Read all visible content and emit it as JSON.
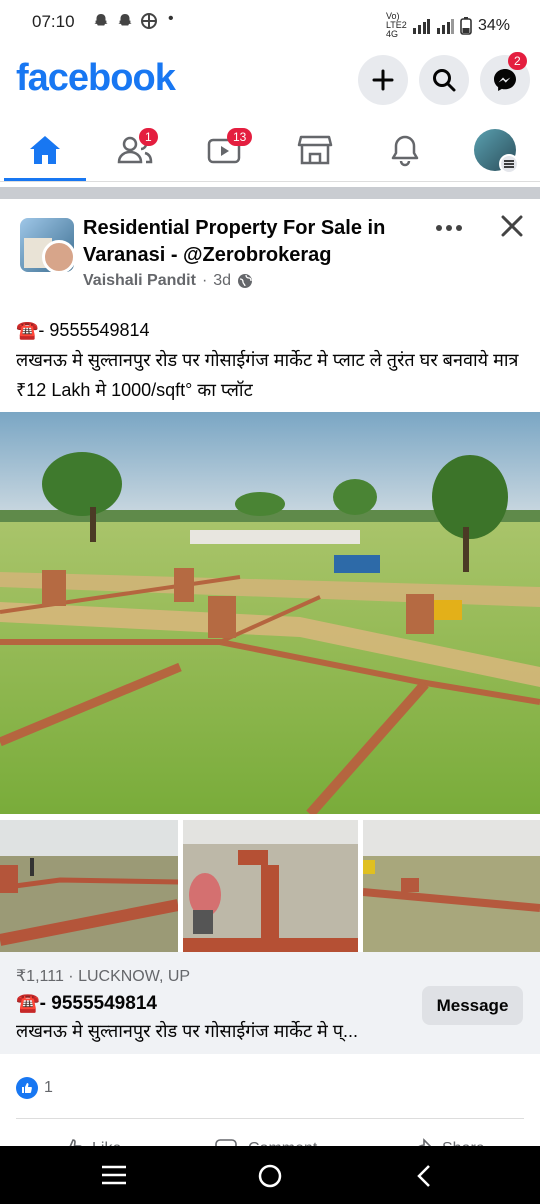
{
  "status_bar": {
    "time": "07:10",
    "network": "Vo) LTE2 4G",
    "battery": "34%"
  },
  "header": {
    "logo": "facebook",
    "messenger_badge": "2"
  },
  "nav": {
    "friends_badge": "1",
    "video_badge": "13"
  },
  "post": {
    "title": "Residential Property For Sale in Varanasi - @Zerobrokerag",
    "author": "Vaishali Pandit",
    "time_ago": "3d",
    "separator": "·",
    "phone_icon": "☎️",
    "phone_line": "- 9555549814",
    "body": "लखनऊ मे सुल्तानपुर रोड पर गोसाईगंज मार्केट मे प्लाट ले तुरंत घर बनवाये मात्र ₹12 Lakh मे 1000/sqft° का प्लॉट"
  },
  "marketplace": {
    "price_location": "₹1,111 · LUCKNOW, UP",
    "phone_line": "- 9555549814",
    "desc": "लखनऊ मे सुल्तानपुर रोड पर गोसाईगंज मार्केट मे प्...",
    "message_button": "Message"
  },
  "reactions": {
    "count": "1"
  },
  "actions": {
    "like": "Like",
    "comment": "Comment",
    "share": "Share"
  },
  "colors": {
    "brand": "#1877f2",
    "badge": "#e41e3f"
  }
}
